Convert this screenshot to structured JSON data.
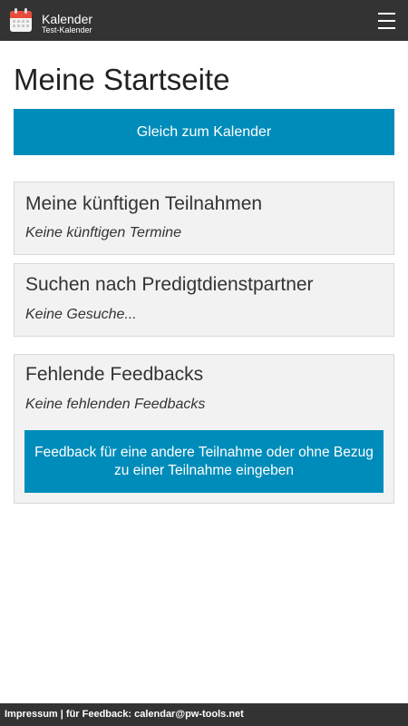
{
  "header": {
    "app_title": "Kalender",
    "app_subtitle": "Test-Kalender",
    "app_icon": "calendar-icon",
    "menu_icon": "hamburger-menu-icon",
    "bar_color": "#333333"
  },
  "main": {
    "page_title": "Meine Startseite",
    "calendar_button_label": "Gleich zum Kalender",
    "accent_color": "#008cba",
    "panels": {
      "participations": {
        "title": "Meine künftigen Teilnahmen",
        "empty_text": "Keine künftigen Termine"
      },
      "search": {
        "title": "Suchen nach Predigtdienstpartner",
        "empty_text": "Keine Gesuche..."
      },
      "feedback": {
        "title": "Fehlende Feedbacks",
        "empty_text": "Keine fehlenden Feedbacks",
        "button_label": "Feedback für eine andere Teilnahme oder ohne Bezug zu einer Teilnahme eingeben"
      }
    }
  },
  "footer": {
    "impressum_label": "Impressum",
    "separator": " | ",
    "feedback_text": "für Feedback: calendar@pw-tools.net"
  }
}
